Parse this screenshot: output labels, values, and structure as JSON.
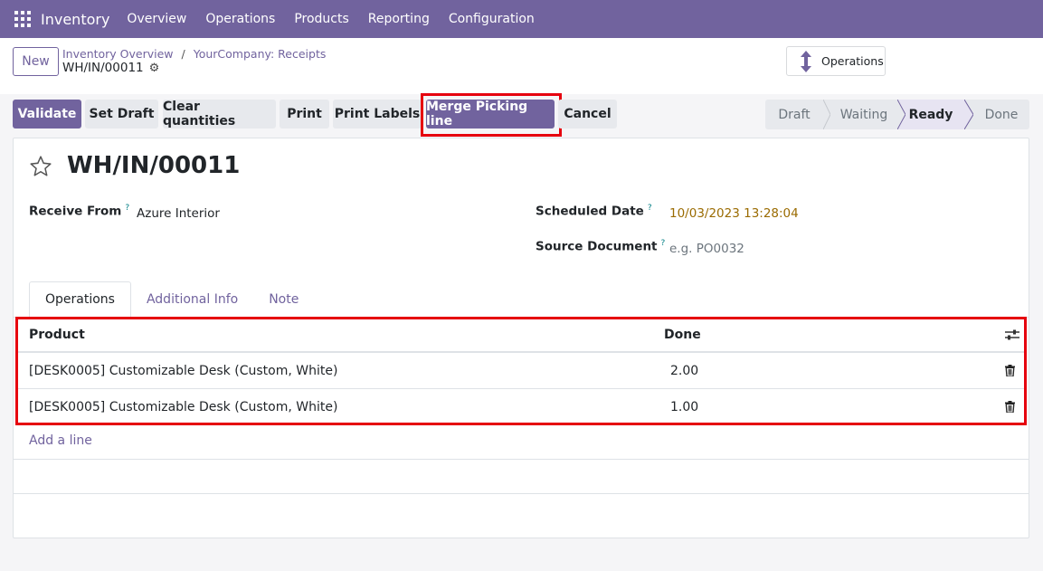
{
  "navbar": {
    "app_icon": "apps-grid-icon",
    "brand": "Inventory",
    "menu": [
      "Overview",
      "Operations",
      "Products",
      "Reporting",
      "Configuration"
    ]
  },
  "control_panel": {
    "new_label": "New",
    "breadcrumb": [
      "Inventory Overview",
      "YourCompany: Receipts"
    ],
    "record_name": "WH/IN/00011",
    "smart_button": {
      "icon": "up-down-arrows-icon",
      "label": "Operations"
    }
  },
  "actions": {
    "buttons": [
      "Validate",
      "Set Draft",
      "Clear quantities",
      "Print",
      "Print Labels",
      "Merge Picking line",
      "Cancel"
    ],
    "status_stages": [
      "Draft",
      "Waiting",
      "Ready",
      "Done"
    ],
    "active_stage": "Ready"
  },
  "form": {
    "title": "WH/IN/00011",
    "receive_from_label": "Receive From",
    "receive_from_value": "Azure Interior",
    "scheduled_date_label": "Scheduled Date",
    "scheduled_date_value": "10/03/2023 13:28:04",
    "source_document_label": "Source Document",
    "source_document_placeholder": "e.g. PO0032",
    "help_marker": "?",
    "tabs": [
      "Operations",
      "Additional Info",
      "Note"
    ],
    "table": {
      "columns": [
        "Product",
        "Done"
      ],
      "rows": [
        {
          "product": "[DESK0005] Customizable Desk (Custom, White)",
          "done": "2.00"
        },
        {
          "product": "[DESK0005] Customizable Desk (Custom, White)",
          "done": "1.00"
        }
      ],
      "add_line": "Add a line"
    }
  },
  "colors": {
    "brand": "#71639e",
    "highlight": "#e6000e",
    "date_warning": "#9a6b01"
  }
}
